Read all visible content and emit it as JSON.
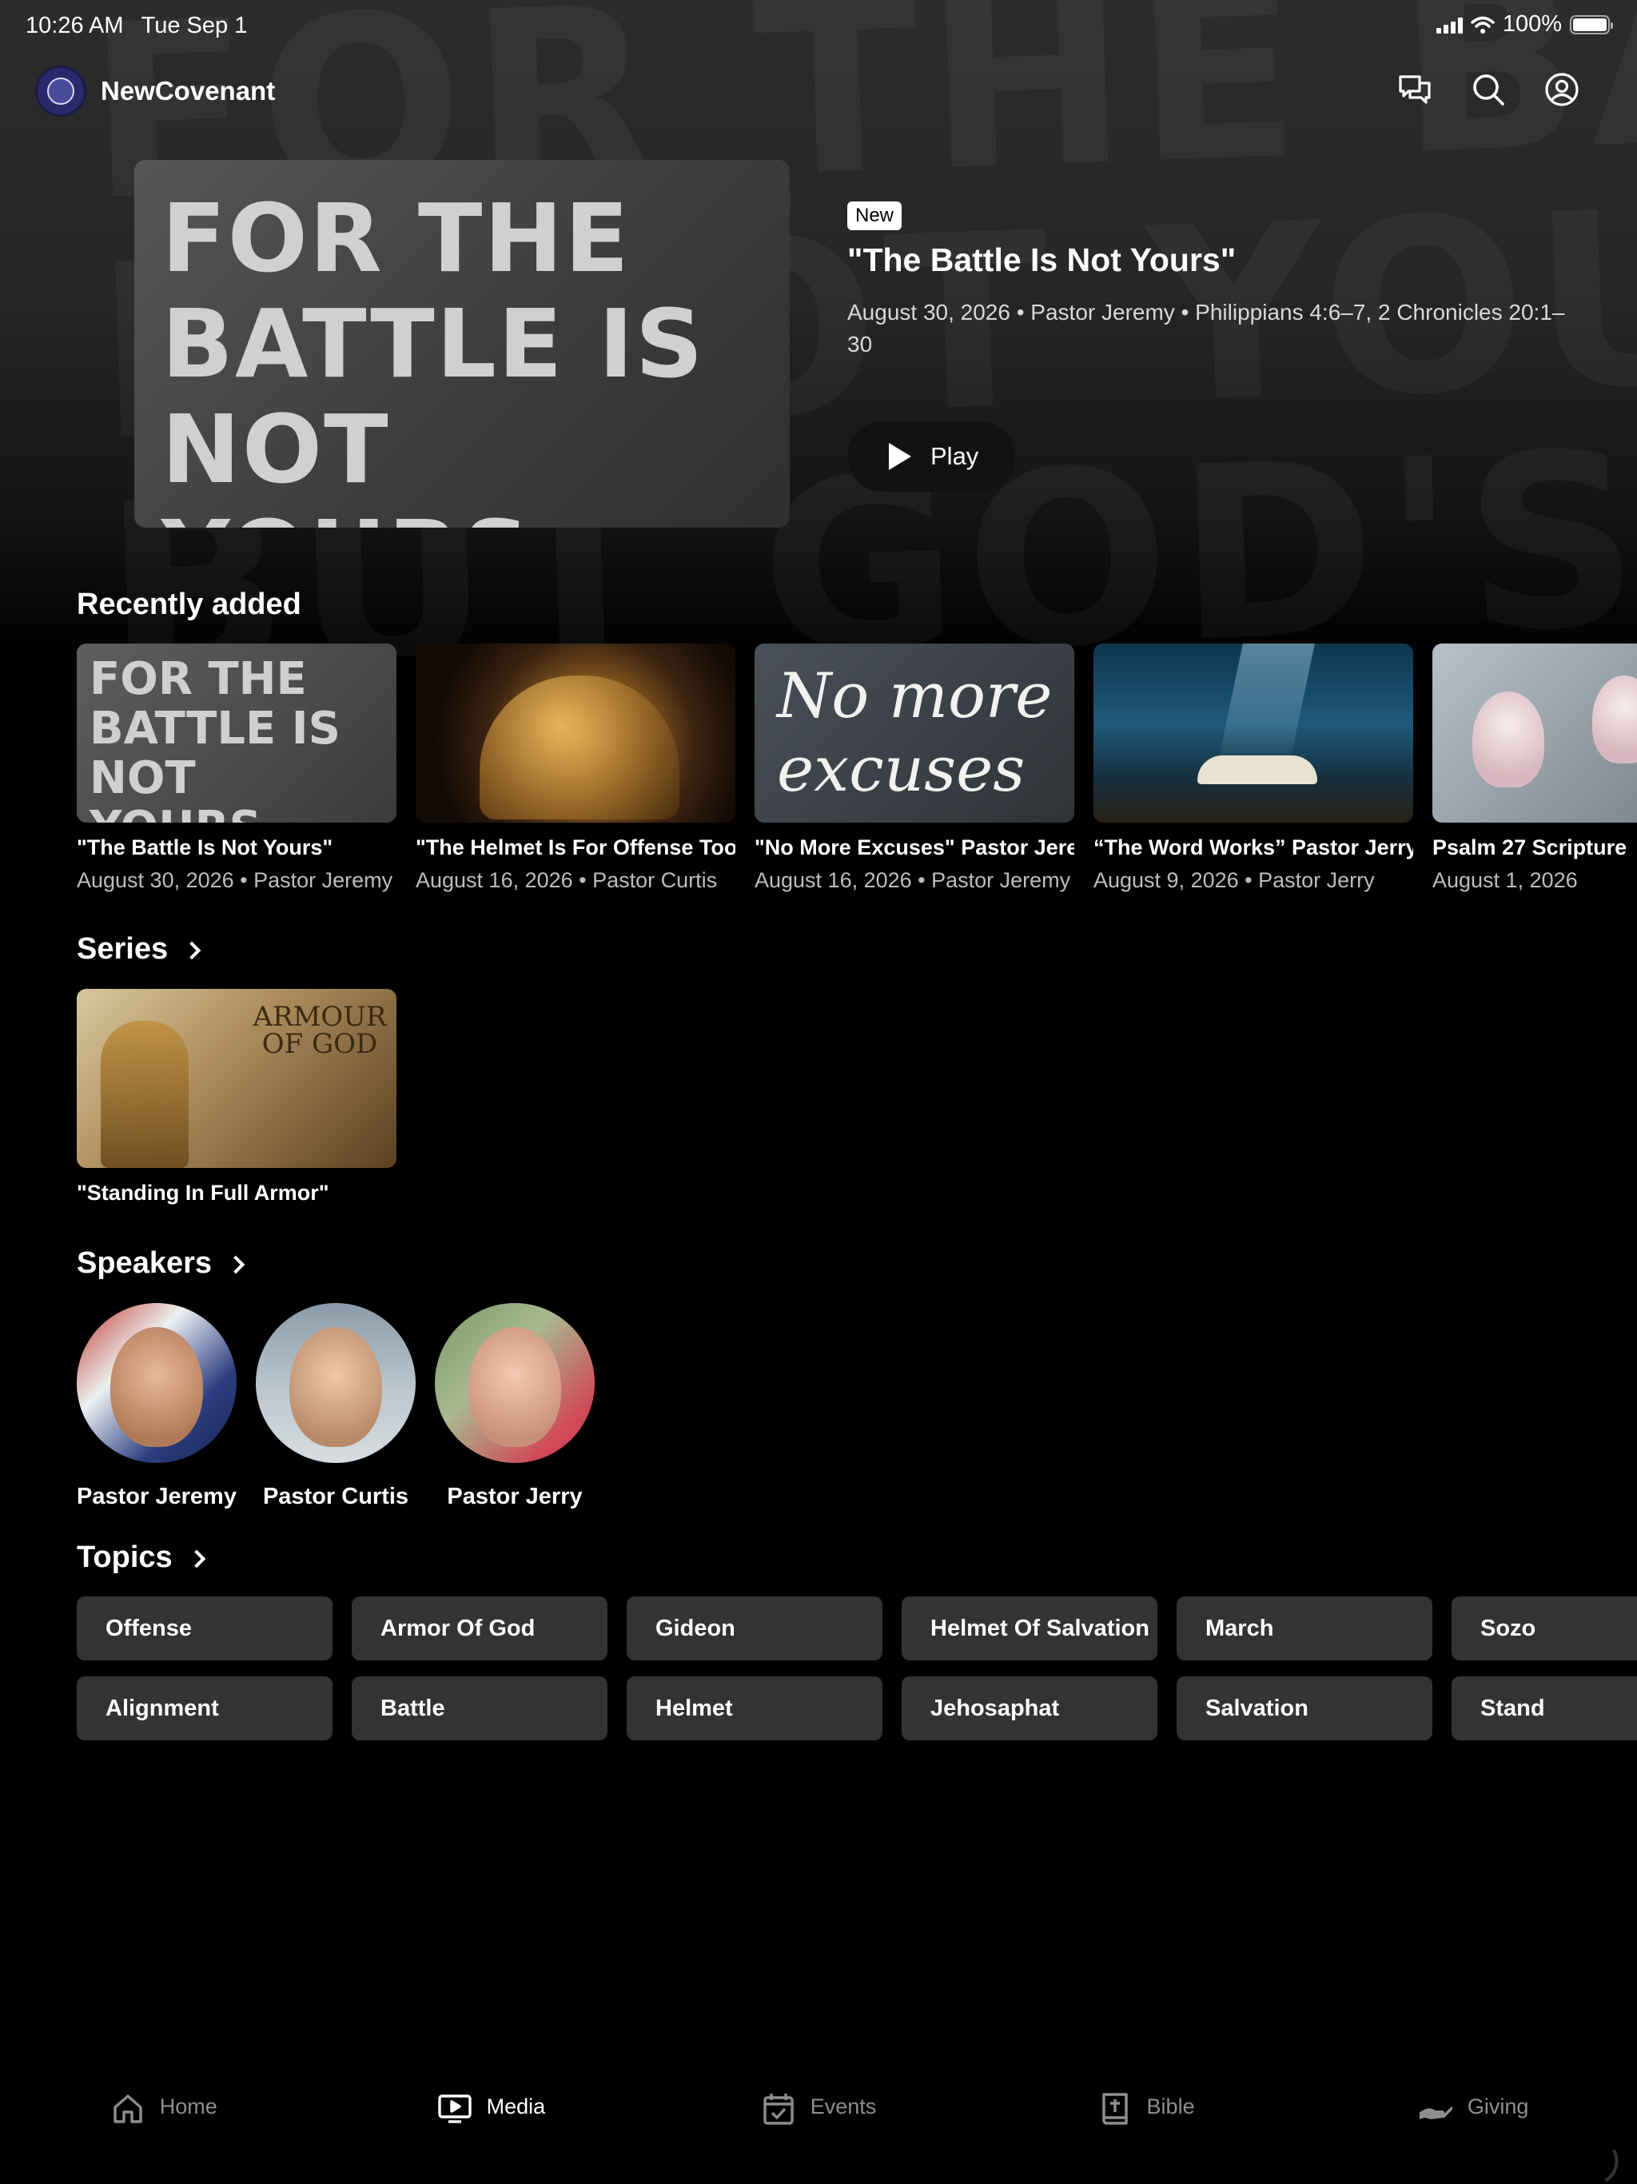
{
  "status_bar": {
    "time": "10:26 AM",
    "date": "Tue Sep 1",
    "battery": "100%"
  },
  "app": {
    "name": "NewCovenant"
  },
  "header_icons": [
    "chat-icon",
    "search-icon",
    "profile-icon"
  ],
  "hero": {
    "background_text": "FOR THE BATTLE\nIS NOT YOURS,\nBUT GOD'S.",
    "art_text": "FOR THE BATTLE IS NOT YOURS, BUT GOD'S.",
    "badge": "New",
    "title": "\"The Battle Is Not Yours\"",
    "meta": "August 30, 2026 • Pastor Jeremy • Philippians 4:6–7, 2 Chronicles 20:1–30",
    "play_label": "Play"
  },
  "recently_added": {
    "title": "Recently added",
    "items": [
      {
        "title": "\"The Battle Is Not Yours\"",
        "subtitle": "August 30, 2026 • Pastor Jeremy",
        "thumb_text": "FOR THE BATTLE IS NOT YOURS, BUT GOD'S."
      },
      {
        "title": "\"The Helmet Is For Offense Too\"",
        "subtitle": "August 16, 2026 • Pastor Curtis",
        "thumb_text": ""
      },
      {
        "title": "\"No More Excuses\" Pastor Jeremy",
        "subtitle": "August 16, 2026 • Pastor Jeremy",
        "thumb_text": "No more excuses"
      },
      {
        "title": "“The Word Works” Pastor Jerry",
        "subtitle": "August 9, 2026 • Pastor Jerry",
        "thumb_text": ""
      },
      {
        "title": "Psalm 27 Scripture",
        "subtitle": "August 1, 2026",
        "thumb_text": ""
      }
    ]
  },
  "series": {
    "title": "Series",
    "items": [
      {
        "title": "\"Standing In Full Armor\"",
        "thumb_title": "ARMOUR OF GOD"
      }
    ]
  },
  "speakers": {
    "title": "Speakers",
    "items": [
      {
        "name": "Pastor Jeremy"
      },
      {
        "name": "Pastor Curtis"
      },
      {
        "name": "Pastor Jerry"
      }
    ]
  },
  "topics": {
    "title": "Topics",
    "row1": [
      "Offense",
      "Armor Of God",
      "Gideon",
      "Helmet Of Salvation",
      "March",
      "Sozo"
    ],
    "row2": [
      "Alignment",
      "Battle",
      "Helmet",
      "Jehosaphat",
      "Salvation",
      "Stand"
    ]
  },
  "tabs": [
    {
      "label": "Home",
      "icon": "home-icon",
      "active": false
    },
    {
      "label": "Media",
      "icon": "media-icon",
      "active": true
    },
    {
      "label": "Events",
      "icon": "calendar-icon",
      "active": false
    },
    {
      "label": "Bible",
      "icon": "bible-icon",
      "active": false
    },
    {
      "label": "Giving",
      "icon": "giving-hand-icon",
      "active": false
    }
  ],
  "colors": {
    "background": "#000000",
    "chip": "#333333",
    "inactive_tab": "#8e8e8e"
  }
}
